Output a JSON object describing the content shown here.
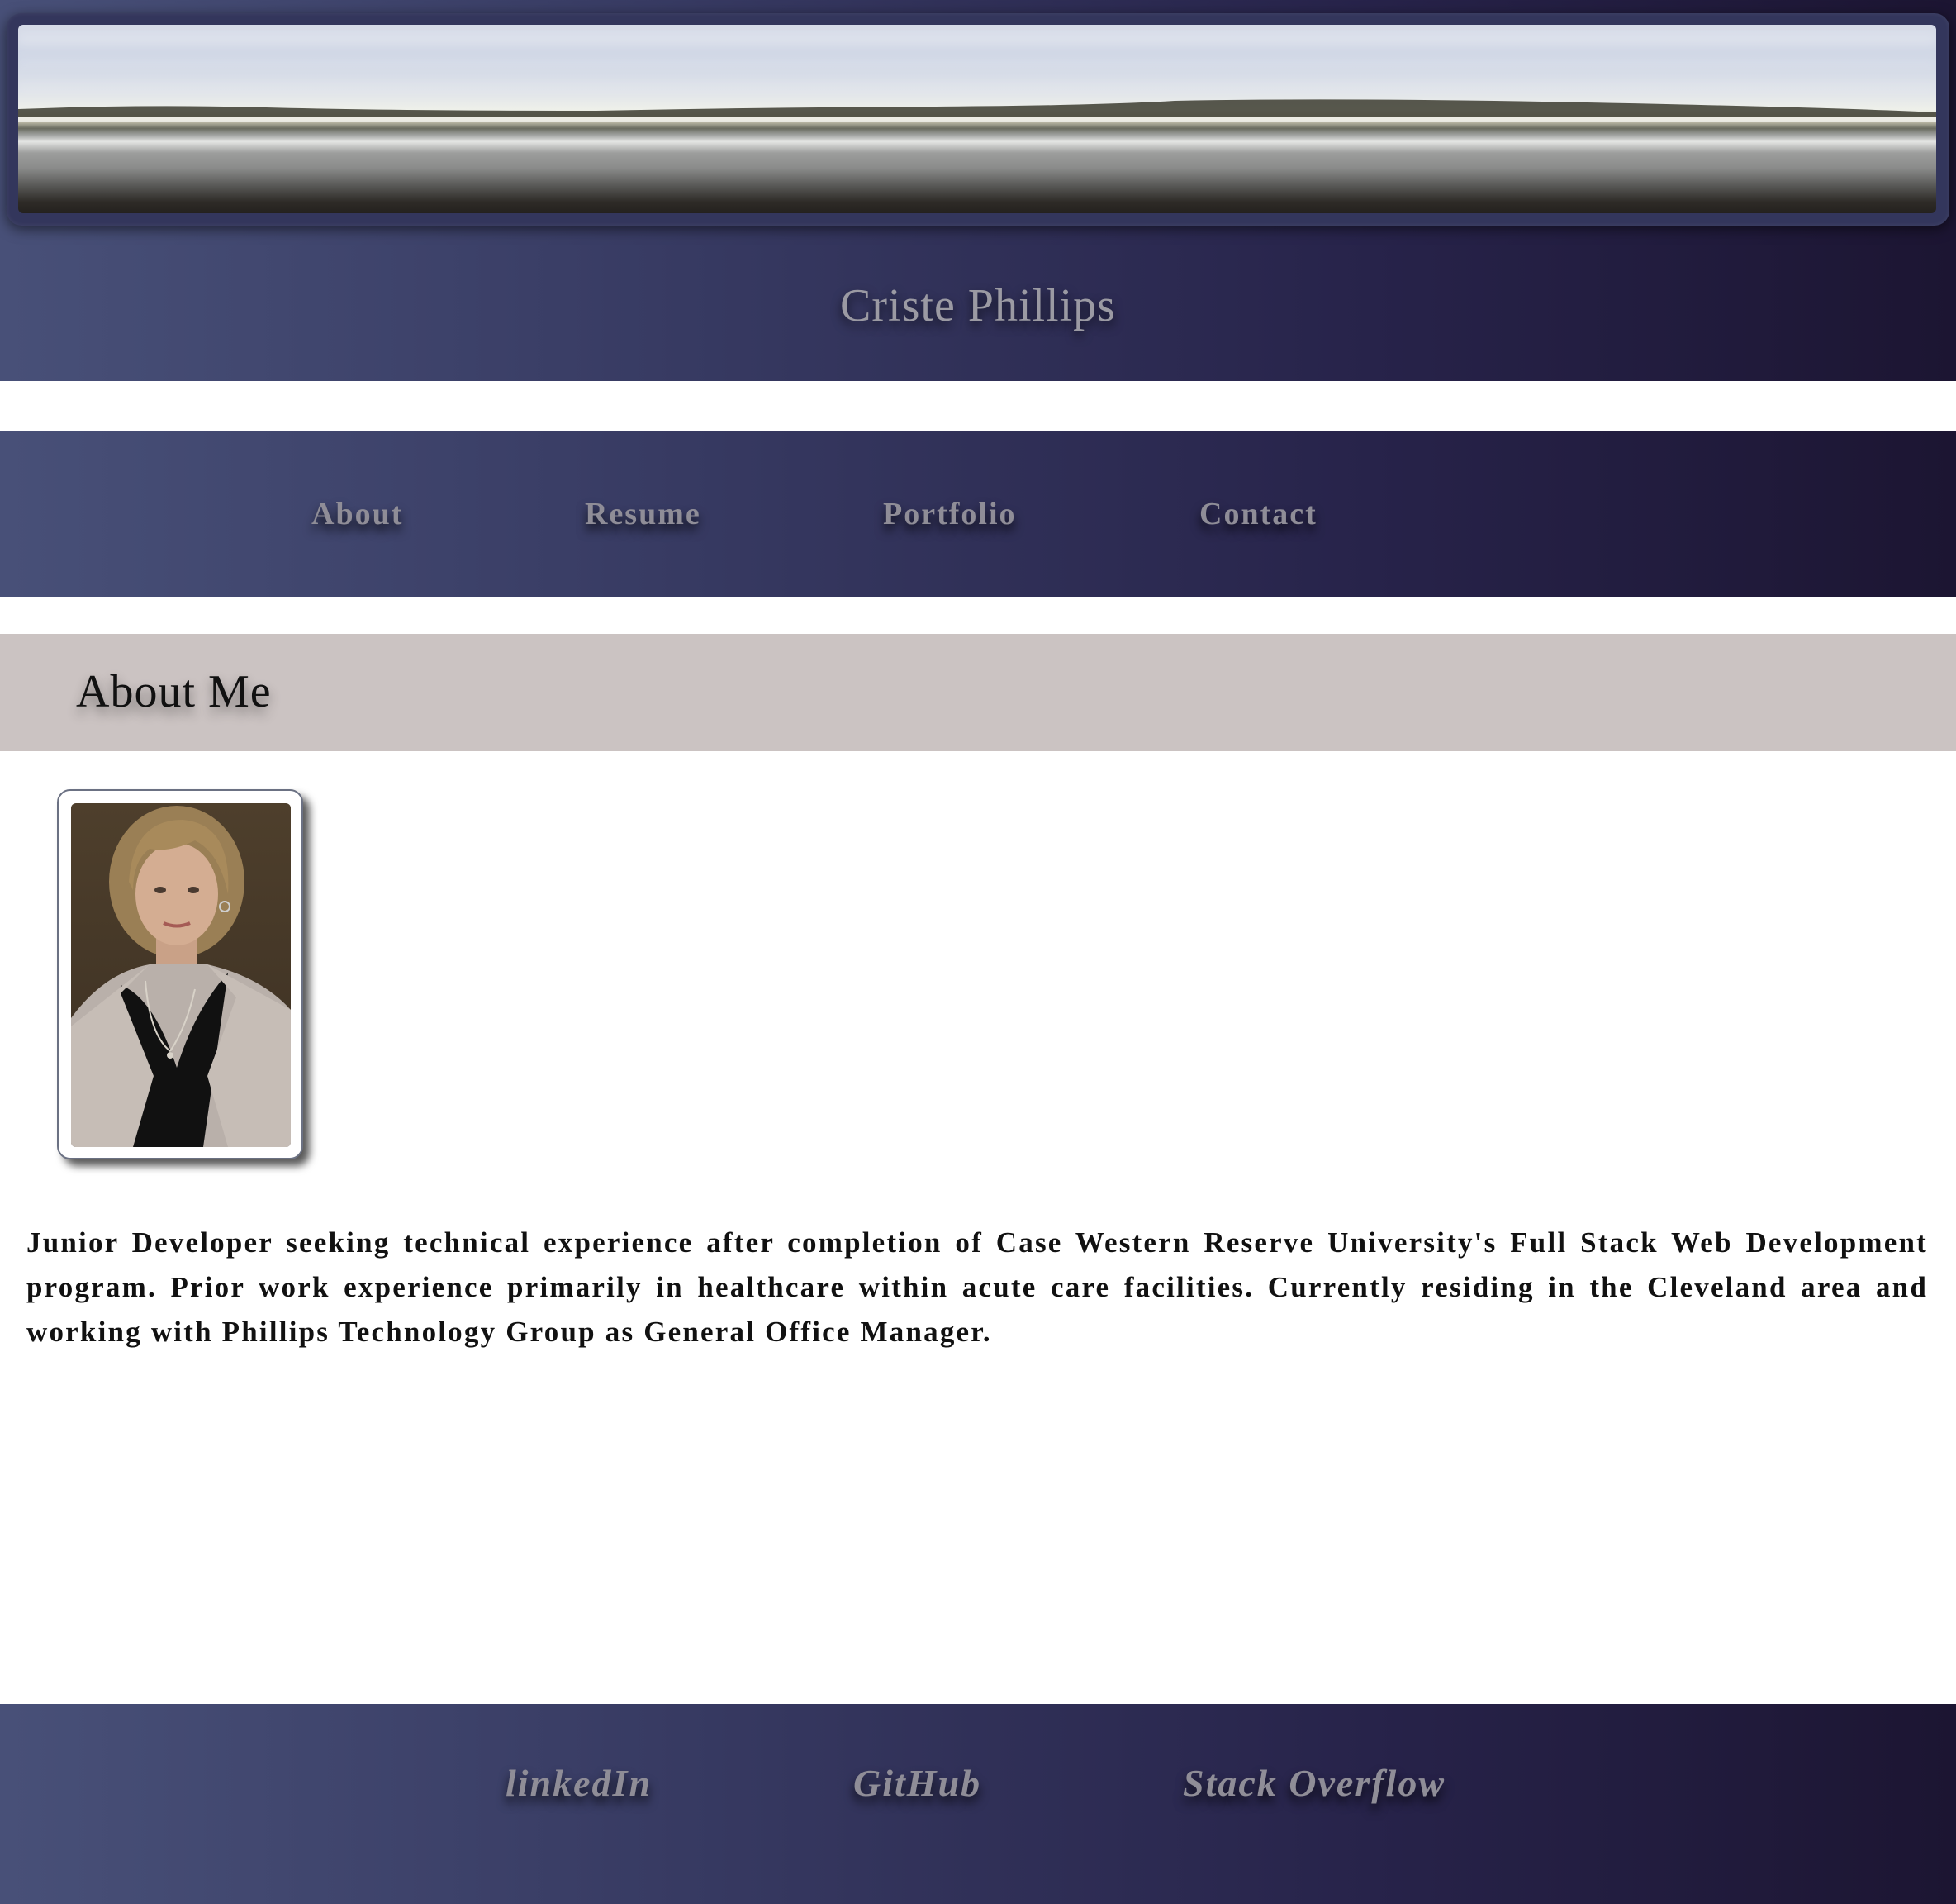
{
  "header": {
    "title": "Criste Phillips"
  },
  "nav": {
    "items": [
      {
        "label": "About"
      },
      {
        "label": "Resume"
      },
      {
        "label": "Portfolio"
      },
      {
        "label": "Contact"
      }
    ]
  },
  "section": {
    "title": "About Me"
  },
  "bio": {
    "text": "Junior Developer seeking technical experience after completion of Case Western Reserve University's Full Stack Web Development program. Prior work experience primarily in healthcare within acute care facilities. Currently residing in the Cleveland area and working with Phillips Technology Group as General Office Manager."
  },
  "footer": {
    "links": [
      {
        "label": "linkedIn"
      },
      {
        "label": "GitHub"
      },
      {
        "label": "Stack Overflow"
      }
    ]
  },
  "colors": {
    "gradient_start": "#485078",
    "gradient_end": "#1c1532",
    "link_text": "#8f8d97",
    "section_bar": "#cbc3c2"
  }
}
